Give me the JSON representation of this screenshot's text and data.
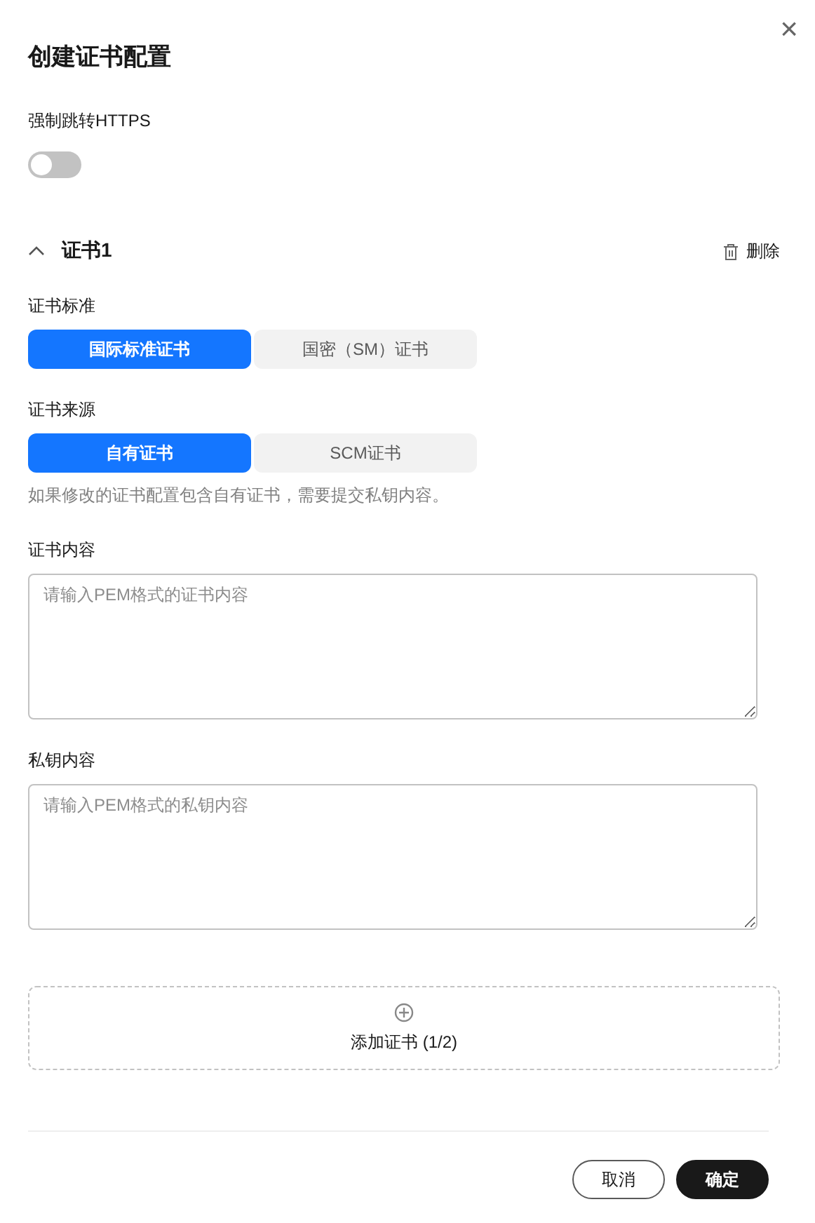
{
  "dialog": {
    "title": "创建证书配置",
    "close": "×"
  },
  "https_redirect": {
    "label": "强制跳转HTTPS",
    "on": false
  },
  "certificate": {
    "title": "证书1",
    "expanded": true,
    "delete": "删除",
    "standard": {
      "label": "证书标准",
      "options": [
        {
          "label": "国际标准证书",
          "selected": true
        },
        {
          "label": "国密（SM）证书",
          "selected": false
        }
      ]
    },
    "source": {
      "label": "证书来源",
      "options": [
        {
          "label": "自有证书",
          "selected": true
        },
        {
          "label": "SCM证书",
          "selected": false
        }
      ],
      "hint": "如果修改的证书配置包含自有证书，需要提交私钥内容。"
    },
    "content": {
      "label": "证书内容",
      "placeholder": "请输入PEM格式的证书内容"
    },
    "private_key": {
      "label": "私钥内容",
      "placeholder": "请输入PEM格式的私钥内容"
    }
  },
  "add_certificate": "添加证书 (1/2)",
  "buttons": [
    {
      "label": "取消",
      "kind": "secondary"
    },
    {
      "label": "确定",
      "kind": "primary"
    }
  ]
}
